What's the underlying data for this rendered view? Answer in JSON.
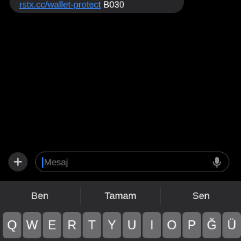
{
  "conversation": {
    "message": {
      "link": "rstx.cc/wallet-protect",
      "suffix": " B030"
    }
  },
  "composer": {
    "add_icon": "plus-icon",
    "placeholder": "Mesaj",
    "mic_icon": "microphone-icon"
  },
  "keyboard": {
    "predictions": [
      "Ben",
      "Tamam",
      "Sen"
    ],
    "row1": [
      "Q",
      "W",
      "E",
      "R",
      "T",
      "Y",
      "U",
      "I",
      "O",
      "P",
      "Ğ",
      "Ü"
    ]
  },
  "colors": {
    "background": "#000000",
    "bubble": "#262629",
    "link": "#3b8cff",
    "keyboard": "#2b2b2d",
    "key": "#6b6b6e",
    "caret": "#2f7cf6"
  }
}
